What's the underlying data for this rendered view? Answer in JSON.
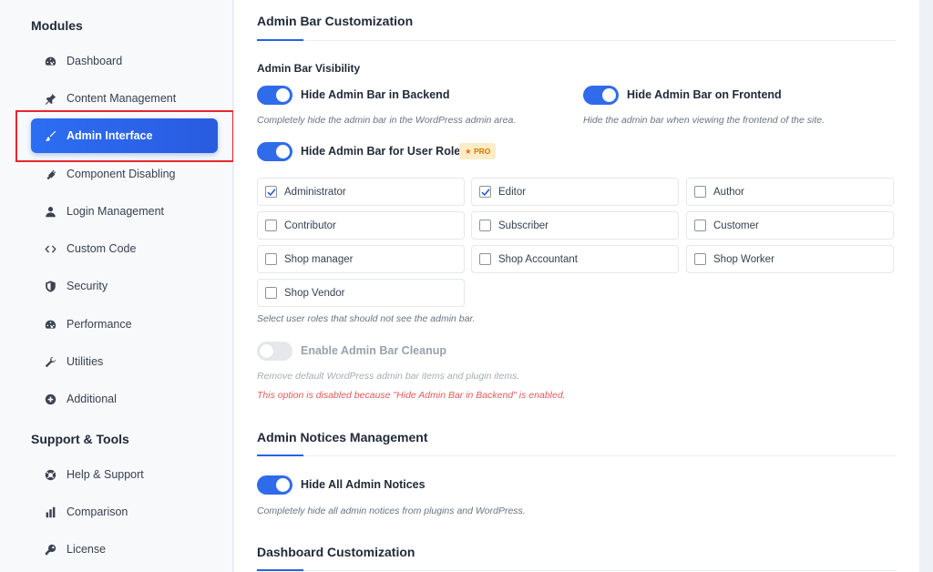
{
  "sidebar": {
    "modules_title": "Modules",
    "modules": [
      {
        "label": "Dashboard",
        "icon": "gauge-icon"
      },
      {
        "label": "Content Management",
        "icon": "pin-icon"
      },
      {
        "label": "Admin Interface",
        "icon": "brush-icon",
        "active": true
      },
      {
        "label": "Component Disabling",
        "icon": "plug-icon"
      },
      {
        "label": "Login Management",
        "icon": "user-icon"
      },
      {
        "label": "Custom Code",
        "icon": "code-icon"
      },
      {
        "label": "Security",
        "icon": "shield-icon"
      },
      {
        "label": "Performance",
        "icon": "gauge-icon"
      },
      {
        "label": "Utilities",
        "icon": "wrench-icon"
      },
      {
        "label": "Additional",
        "icon": "plus-circle-icon"
      }
    ],
    "support_title": "Support & Tools",
    "support": [
      {
        "label": "Help & Support",
        "icon": "lifebuoy-icon"
      },
      {
        "label": "Comparison",
        "icon": "bar-chart-icon"
      },
      {
        "label": "License",
        "icon": "key-icon"
      }
    ]
  },
  "admin_bar": {
    "title": "Admin Bar Customization",
    "visibility_label": "Admin Bar Visibility",
    "backend_label": "Hide Admin Bar in Backend",
    "backend_desc": "Completely hide the admin bar in the WordPress admin area.",
    "frontend_label": "Hide Admin Bar on Frontend",
    "frontend_desc": "Hide the admin bar when viewing the frontend of the site.",
    "roles_label": "Hide Admin Bar for User Roles",
    "pro_badge": "★ PRO",
    "roles": [
      {
        "label": "Administrator",
        "checked": true
      },
      {
        "label": "Editor",
        "checked": true
      },
      {
        "label": "Author",
        "checked": false
      },
      {
        "label": "Contributor",
        "checked": false
      },
      {
        "label": "Subscriber",
        "checked": false
      },
      {
        "label": "Customer",
        "checked": false
      },
      {
        "label": "Shop manager",
        "checked": false
      },
      {
        "label": "Shop Accountant",
        "checked": false
      },
      {
        "label": "Shop Worker",
        "checked": false
      },
      {
        "label": "Shop Vendor",
        "checked": false
      }
    ],
    "roles_desc": "Select user roles that should not see the admin bar.",
    "cleanup_label": "Enable Admin Bar Cleanup",
    "cleanup_desc": "Remove default WordPress admin bar items and plugin items.",
    "cleanup_warning": "This option is disabled because \"Hide Admin Bar in Backend\" is enabled."
  },
  "notices": {
    "title": "Admin Notices Management",
    "hide_label": "Hide All Admin Notices",
    "hide_desc": "Completely hide all admin notices from plugins and WordPress."
  },
  "dashboard": {
    "title": "Dashboard Customization"
  },
  "colors": {
    "accent": "#2563eb",
    "warning": "#e25a5a",
    "pro_badge_bg": "#fdecc8"
  }
}
